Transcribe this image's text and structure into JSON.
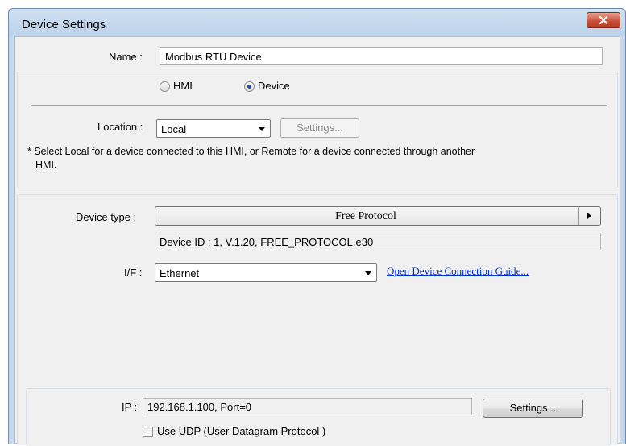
{
  "window": {
    "title": "Device Settings"
  },
  "name_field": {
    "label": "Name :",
    "value": "Modbus RTU Device"
  },
  "target": {
    "options": [
      {
        "label": "HMI",
        "checked": false
      },
      {
        "label": "Device",
        "checked": true
      }
    ]
  },
  "location": {
    "label": "Location :",
    "selected": "Local",
    "settings_label": "Settings...",
    "hint_line1": "* Select Local for a device connected to this HMI, or Remote for a device connected through another",
    "hint_line2": "HMI."
  },
  "device_type": {
    "label": "Device type :",
    "value": "Free Protocol",
    "info": "Device ID : 1, V.1.20, FREE_PROTOCOL.e30"
  },
  "interface": {
    "label": "I/F :",
    "selected": "Ethernet",
    "guide_link": "Open Device Connection Guide..."
  },
  "ip": {
    "label": "IP :",
    "value": "192.168.1.100, Port=0",
    "settings_label": "Settings...",
    "use_udp_label": "Use UDP (User Datagram Protocol )",
    "use_udp_checked": false
  },
  "colors": {
    "link": "#0033cc",
    "close_button": "#c9503a",
    "title_bar": "#c6d8ec"
  },
  "icons": {
    "close": "close-icon",
    "combo_arrow": "chevron-down-icon",
    "device_type_arrow": "chevron-right-icon"
  }
}
